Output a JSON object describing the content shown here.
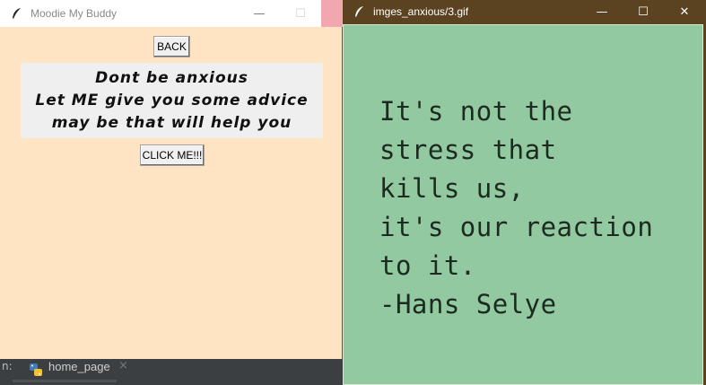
{
  "left_window": {
    "title": "Moodie My Buddy",
    "minimize_glyph": "—",
    "maximize_glyph": "☐",
    "back_label": "BACK",
    "advice_lines": [
      "Dont be anxious",
      "Let ME give you some advice",
      "may be that will help you"
    ],
    "click_label": "CLICK ME!!!"
  },
  "editor_strip": {
    "prefix": "n:",
    "tab_label": "home_page",
    "tab_close": "×",
    "icon": "python-icon"
  },
  "right_window": {
    "title": "imges_anxious/3.gif",
    "minimize_glyph": "—",
    "maximize_glyph": "☐",
    "close_glyph": "✕",
    "quote_lines": [
      "It's not the",
      "stress that",
      "kills us,",
      "it's our reaction",
      "to it.",
      "-Hans Selye"
    ]
  },
  "colors": {
    "left_bg": "#ffe4c4",
    "right_titlebar": "#5b4321",
    "quote_bg": "#93c9a0"
  }
}
